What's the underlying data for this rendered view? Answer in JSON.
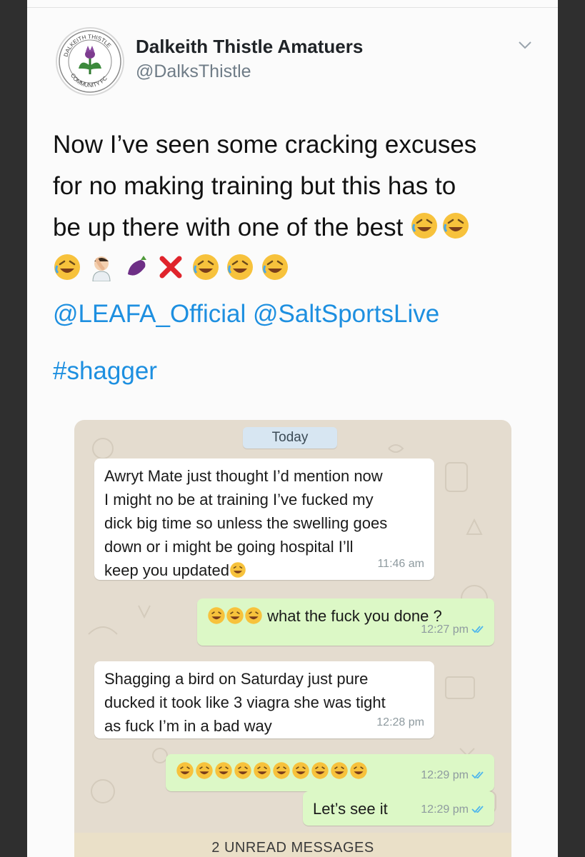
{
  "tweet": {
    "author_name": "Dalkeith Thistle Amatuers",
    "author_handle": "@DalksThistle",
    "avatar_text_top": "DALKEITH THISTLE",
    "avatar_text_bottom": "COMMUNITY FC",
    "text_lines": [
      "Now I’ve seen some cracking excuses",
      "for no making training but this has to",
      "be up there with one of the best"
    ],
    "emoji_line1": [
      "rofl-icon",
      "rofl-icon"
    ],
    "emoji_line2": [
      "rofl-icon",
      "facepalm-icon",
      "eggplant-icon",
      "cross-mark-icon",
      "rofl-icon",
      "rofl-icon",
      "rofl-icon"
    ],
    "mentions": [
      "@LEAFA_Official",
      "@SaltSportsLive"
    ],
    "hashtag": "#shagger"
  },
  "chat": {
    "date_label": "Today",
    "messages": [
      {
        "direction": "in",
        "lines": [
          "Awryt Mate just thought I’d mention now",
          "I might no be at training I’ve fucked my",
          "dick big time so unless the swelling goes",
          "down or i might be going hospital I’ll",
          "keep you updated"
        ],
        "time": "11:46 am"
      },
      {
        "direction": "out",
        "text": "what the fuck you done ?",
        "time": "12:27 pm"
      },
      {
        "direction": "in",
        "lines": [
          "Shagging a bird on Saturday just pure",
          "ducked it took like 3 viagra she was tight",
          "as fuck I’m in a bad way"
        ],
        "time": "12:28 pm"
      },
      {
        "direction": "out",
        "emoji_count": 10,
        "time": "12:29 pm"
      },
      {
        "direction": "out",
        "text": "Let’s see it",
        "time": "12:29 pm"
      }
    ],
    "unread_banner": "2 UNREAD MESSAGES"
  },
  "colors": {
    "link": "#1d8fe0",
    "incoming_bubble": "#ffffff",
    "outgoing_bubble": "#dcf8c6",
    "chat_background": "#e4dccf",
    "read_tick": "#4fb6ec"
  }
}
